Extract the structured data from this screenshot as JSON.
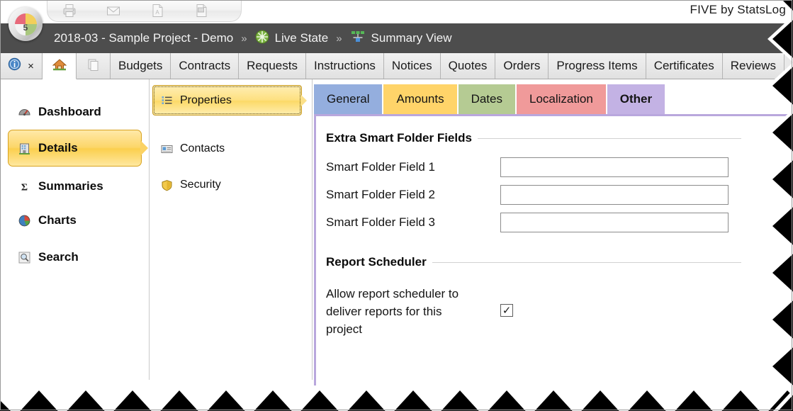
{
  "app": {
    "brand": "FIVE by StatsLog",
    "logo_label": "5",
    "logo_name": "five-logo"
  },
  "toolbar": {
    "items": [
      {
        "name": "print-icon",
        "label": "Print"
      },
      {
        "name": "email-icon",
        "label": "Email"
      },
      {
        "name": "pdf-icon",
        "label": "Export PDF"
      },
      {
        "name": "excel-icon",
        "label": "Export Excel"
      }
    ]
  },
  "breadcrumb": {
    "project": "2018-03 - Sample Project - Demo",
    "sep1": "»",
    "state": "Live State",
    "sep2": "»",
    "view": "Summary View"
  },
  "ribbon": {
    "close_label": "×",
    "tabs": [
      {
        "label": "Budgets"
      },
      {
        "label": "Contracts"
      },
      {
        "label": "Requests"
      },
      {
        "label": "Instructions"
      },
      {
        "label": "Notices"
      },
      {
        "label": "Quotes"
      },
      {
        "label": "Orders"
      },
      {
        "label": "Progress Items"
      },
      {
        "label": "Certificates"
      },
      {
        "label": "Reviews"
      }
    ]
  },
  "sidebar": {
    "items": [
      {
        "label": "Dashboard",
        "icon": "gauge-icon",
        "selected": false
      },
      {
        "label": "Details",
        "icon": "building-icon",
        "selected": true
      },
      {
        "label": "Summaries",
        "icon": "sigma-icon",
        "selected": false
      },
      {
        "label": "Charts",
        "icon": "pie-chart-icon",
        "selected": false
      },
      {
        "label": "Search",
        "icon": "magnifier-icon",
        "selected": false
      }
    ]
  },
  "subnav": {
    "items": [
      {
        "label": "Properties",
        "icon": "list-icon",
        "selected": true
      },
      {
        "label": "Contacts",
        "icon": "contact-card-icon",
        "selected": false
      },
      {
        "label": "Security",
        "icon": "shield-icon",
        "selected": false
      }
    ]
  },
  "content": {
    "tabs": [
      {
        "label": "General",
        "color": "#94aede",
        "current": false
      },
      {
        "label": "Amounts",
        "color": "#ffd469",
        "current": false
      },
      {
        "label": "Dates",
        "color": "#b5cb93",
        "current": false
      },
      {
        "label": "Localization",
        "color": "#f09a9a",
        "current": false
      },
      {
        "label": "Other",
        "color": "#c3b2e4",
        "current": true
      }
    ],
    "panel_border_color": "#b9a7dd",
    "sections": [
      {
        "title": "Extra Smart Folder Fields",
        "fields": [
          {
            "label": "Smart Folder Field 1",
            "value": "",
            "placeholder": ""
          },
          {
            "label": "Smart Folder Field 2",
            "value": "",
            "placeholder": ""
          },
          {
            "label": "Smart Folder Field 3",
            "value": "",
            "placeholder": ""
          }
        ]
      },
      {
        "title": "Report Scheduler",
        "checkbox": {
          "label": "Allow report scheduler to deliver reports for this project",
          "checked": true,
          "mark": "✓"
        }
      }
    ]
  }
}
